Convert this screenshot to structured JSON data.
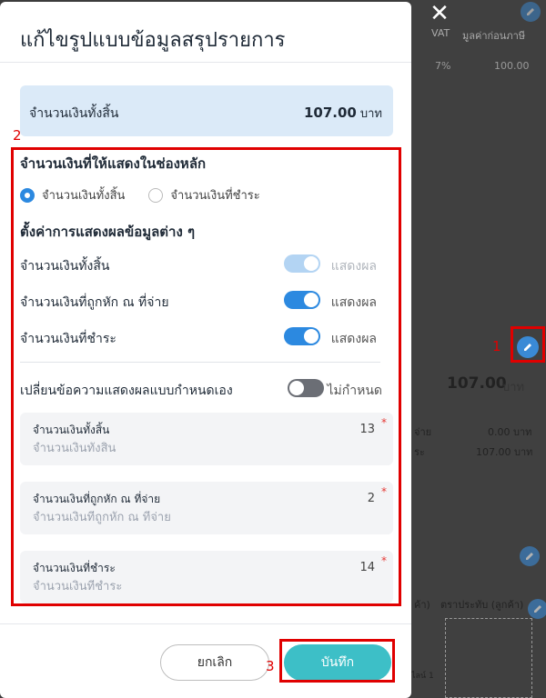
{
  "modal": {
    "title": "แก้ไขรูปแบบข้อมูลสรุปรายการ",
    "close_glyph": "✕",
    "total": {
      "label": "จำนวนเงินทั้งสิ้น",
      "value": "107.00",
      "unit": "บาท"
    },
    "main_amount_heading": "จำนวนเงินที่ให้แสดงในช่องหลัก",
    "radio_options": [
      {
        "label": "จำนวนเงินทั้งสิ้น",
        "checked": true
      },
      {
        "label": "จำนวนเงินที่ชำระ",
        "checked": false
      }
    ],
    "display_settings_heading": "ตั้งค่าการแสดงผลข้อมูลต่าง ๆ",
    "toggles": [
      {
        "label": "จำนวนเงินทั้งสิ้น",
        "state": "แสดงผล",
        "on": true,
        "disabled": true
      },
      {
        "label": "จำนวนเงินที่ถูกหัก ณ ที่จ่าย",
        "state": "แสดงผล",
        "on": true,
        "disabled": false
      },
      {
        "label": "จำนวนเงินที่ชำระ",
        "state": "แสดงผล",
        "on": true,
        "disabled": false
      }
    ],
    "custom_toggle": {
      "label": "เปลี่ยนข้อความแสดงผลแบบกำหนดเอง",
      "state": "ไม่กำหนด",
      "on": false
    },
    "fields": [
      {
        "label": "จำนวนเงินทั้งสิ้น",
        "count": "13",
        "required": "*",
        "placeholder": "จำนวนเงินทั้งสิ้น",
        "value": ""
      },
      {
        "label": "จำนวนเงินที่ถูกหัก ณ ที่จ่าย",
        "count": "2",
        "required": "*",
        "placeholder": "จำนวนเงินที่ถูกหัก ณ ที่จ่าย",
        "value": ""
      },
      {
        "label": "จำนวนเงินที่ชำระ",
        "count": "14",
        "required": "*",
        "placeholder": "จำนวนเงินที่ชำระ",
        "value": ""
      }
    ],
    "cancel_label": "ยกเลิก",
    "save_label": "บันทึก"
  },
  "background": {
    "col_vat": "VAT",
    "col_pretax": "มูลค่าก่อนภาษี",
    "row_vat": "7%",
    "row_pretax": "100.00",
    "summary_total": "107.00",
    "summary_unit": "บาท",
    "line1_value": "0.00 บาท",
    "line1_label_partial": "จ่าย",
    "line2_value": "107.00 บาท",
    "line2_label_partial": "ระ",
    "sign_label_partial": "ค้า)",
    "stamp_label": "ตราประทับ (ลูกค้า)",
    "date_label_partial": "ไลน์ 1"
  },
  "annotations": {
    "n1": "1",
    "n2": "2",
    "n3": "3"
  },
  "colors": {
    "accent": "#2c89e0",
    "save": "#3dbfc7",
    "annotation": "#e00000"
  }
}
